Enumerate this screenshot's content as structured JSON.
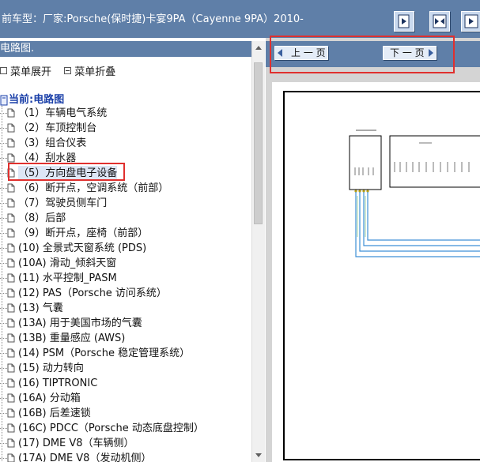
{
  "header": {
    "title": "前车型：厂家:Porsche(保时捷)卡宴9PA（Cayenne 9PA）2010-"
  },
  "toolbar": {
    "buttons": [
      {
        "name": "view-single-icon"
      },
      {
        "name": "view-split-icon"
      },
      {
        "name": "view-next-icon"
      }
    ]
  },
  "tree_panel": {
    "heading": "电路图.",
    "expand_all": "菜单展开",
    "collapse_all": "菜单折叠",
    "root": "当前:电路图",
    "items": [
      "（1）车辆电气系统",
      "（2）车顶控制台",
      "（3）组合仪表",
      "（4）刮水器",
      "（5）方向盘电子设备",
      "（6）断开点，空调系统（前部）",
      "（7）驾驶员侧车门",
      "（8）后部",
      "（9）断开点，座椅（前部）",
      "(10) 全景式天窗系统 (PDS)",
      "(10A) 滑动_倾斜天窗",
      "(11) 水平控制_PASM",
      "(12) PAS（Porsche 访问系统）",
      "(13) 气囊",
      "(13A) 用于美国市场的气囊",
      "(13B) 重量感应 (AWS)",
      "(14) PSM（Porsche 稳定管理系统）",
      "(15) 动力转向",
      "(16) TIPTRONIC",
      "(16A) 分动箱",
      "(16B) 后差速锁",
      "(16C) PDCC（Porsche 动态底盘控制）",
      "(17) DME V8（车辆侧）",
      "(17A) DME V8（发动机侧）"
    ],
    "selected_index": 4
  },
  "navigation": {
    "prev_label": "上 一 页",
    "next_label": "下 一 页"
  },
  "colors": {
    "header_bg": "#5f7fa8",
    "highlight": "#e0302e",
    "tree_root": "#1a3fa8",
    "wire": "#3d8fd6"
  }
}
